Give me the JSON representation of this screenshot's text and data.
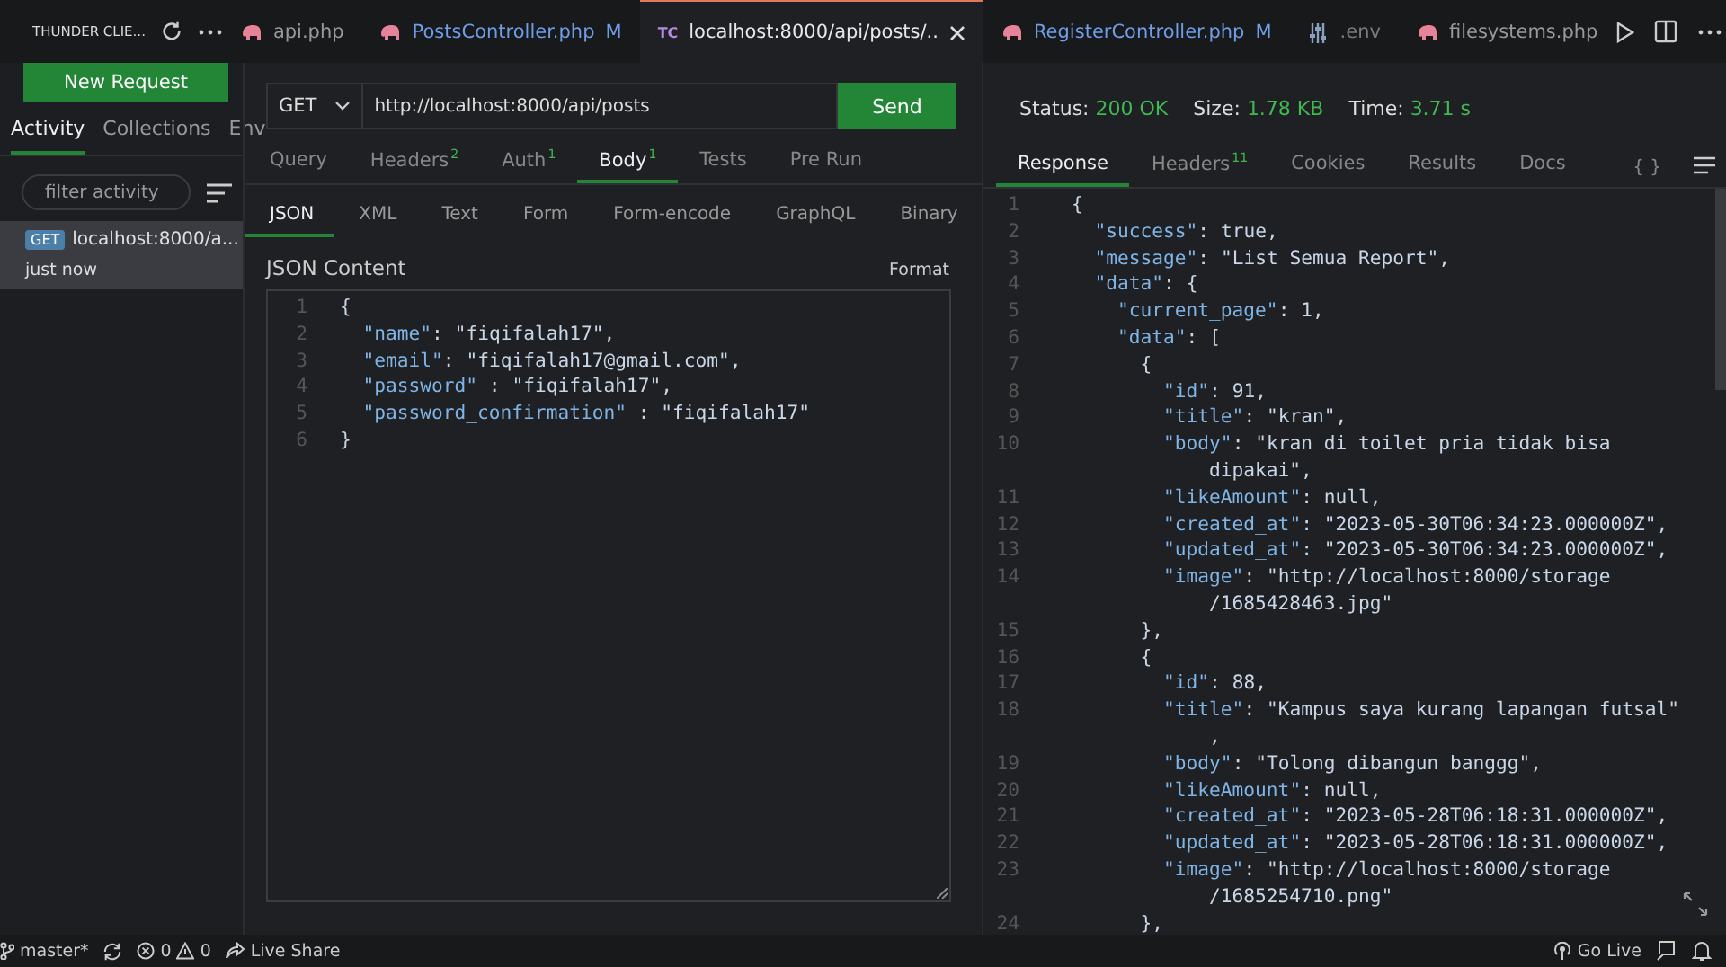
{
  "editor_tabs": [
    {
      "label": "api.php",
      "kind": "php",
      "selected": false
    },
    {
      "label": "PostsController.php",
      "kind": "php",
      "modified": "M",
      "selected": false
    },
    {
      "label": "localhost:8000/api/posts/..",
      "kind": "thunder",
      "icon_text": "TC",
      "selected": true
    },
    {
      "label": "RegisterController.php",
      "kind": "php",
      "modified": "M",
      "selected": false
    },
    {
      "label": ".env",
      "kind": "env",
      "selected": false
    },
    {
      "label": "filesystems.php",
      "kind": "php",
      "selected": false
    }
  ],
  "sidebar": {
    "title": "THUNDER CLIE...",
    "new_request": "New Request",
    "tabs": [
      {
        "label": "Activity",
        "selected": true
      },
      {
        "label": "Collections",
        "selected": false
      },
      {
        "label": "Env",
        "selected": false
      }
    ],
    "filter": {
      "placeholder": "filter activity"
    },
    "items": [
      {
        "method": "GET",
        "url": "localhost:8000/a...",
        "time": "just now",
        "selected": true
      }
    ]
  },
  "request": {
    "method": "GET",
    "url": "http://localhost:8000/api/posts",
    "send": "Send",
    "tabs": [
      {
        "label": "Query",
        "selected": false
      },
      {
        "label": "Headers",
        "badge": "2",
        "selected": false
      },
      {
        "label": "Auth",
        "badge": "1",
        "selected": false
      },
      {
        "label": "Body",
        "badge": "1",
        "selected": true
      },
      {
        "label": "Tests",
        "selected": false
      },
      {
        "label": "Pre Run",
        "selected": false
      }
    ],
    "body_tabs": [
      {
        "label": "JSON",
        "selected": true
      },
      {
        "label": "XML",
        "selected": false
      },
      {
        "label": "Text",
        "selected": false
      },
      {
        "label": "Form",
        "selected": false
      },
      {
        "label": "Form-encode",
        "selected": false
      },
      {
        "label": "GraphQL",
        "selected": false
      },
      {
        "label": "Binary",
        "selected": false
      }
    ],
    "content_label": "JSON Content",
    "format": "Format",
    "lines": [
      {
        "number": "1",
        "text": "{"
      },
      {
        "number": "2",
        "text": "  \"name\": \"fiqifalah17\","
      },
      {
        "number": "3",
        "text": "  \"email\": \"fiqifalah17@gmail.com\","
      },
      {
        "number": "4",
        "text": "  \"password\" : \"fiqifalah17\","
      },
      {
        "number": "5",
        "text": "  \"password_confirmation\" : \"fiqifalah17\""
      },
      {
        "number": "6",
        "text": "}"
      }
    ]
  },
  "response": {
    "status_label": "Status:",
    "status": "200 OK",
    "size_label": "Size:",
    "size": "1.78 KB",
    "time_label": "Time:",
    "time": "3.71 s",
    "tabs": [
      {
        "label": "Response",
        "selected": true
      },
      {
        "label": "Headers",
        "badge": "11",
        "selected": false
      },
      {
        "label": "Cookies",
        "selected": false
      },
      {
        "label": "Results",
        "selected": false
      },
      {
        "label": "Docs",
        "selected": false
      }
    ],
    "braces": "{ }",
    "lines": [
      {
        "number": "1",
        "text": "{"
      },
      {
        "number": "2",
        "text": "  \"success\": true,"
      },
      {
        "number": "3",
        "text": "  \"message\": \"List Semua Report\","
      },
      {
        "number": "4",
        "text": "  \"data\": {"
      },
      {
        "number": "5",
        "text": "    \"current_page\": 1,"
      },
      {
        "number": "6",
        "text": "    \"data\": ["
      },
      {
        "number": "7",
        "text": "      {"
      },
      {
        "number": "8",
        "text": "        \"id\": 91,"
      },
      {
        "number": "9",
        "text": "        \"title\": \"kran\","
      },
      {
        "number": "10",
        "text": "        \"body\": \"kran di toilet pria tidak bisa"
      },
      {
        "text": "            dipakai\","
      },
      {
        "number": "11",
        "text": "        \"likeAmount\": null,"
      },
      {
        "number": "12",
        "text": "        \"created_at\": \"2023-05-30T06:34:23.000000Z\","
      },
      {
        "number": "13",
        "text": "        \"updated_at\": \"2023-05-30T06:34:23.000000Z\","
      },
      {
        "number": "14",
        "text": "        \"image\": \"http://localhost:8000/storage"
      },
      {
        "text": "            /1685428463.jpg\""
      },
      {
        "number": "15",
        "text": "      },"
      },
      {
        "number": "16",
        "text": "      {"
      },
      {
        "number": "17",
        "text": "        \"id\": 88,"
      },
      {
        "number": "18",
        "text": "        \"title\": \"Kampus saya kurang lapangan futsal\""
      },
      {
        "text": "            ,"
      },
      {
        "number": "19",
        "text": "        \"body\": \"Tolong dibangun banggg\","
      },
      {
        "number": "20",
        "text": "        \"likeAmount\": null,"
      },
      {
        "number": "21",
        "text": "        \"created_at\": \"2023-05-28T06:18:31.000000Z\","
      },
      {
        "number": "22",
        "text": "        \"updated_at\": \"2023-05-28T06:18:31.000000Z\","
      },
      {
        "number": "23",
        "text": "        \"image\": \"http://localhost:8000/storage"
      },
      {
        "text": "            /1685254710.png\""
      },
      {
        "number": "24",
        "text": "      },"
      }
    ]
  },
  "status_bar": {
    "branch": "master*",
    "errors": "0",
    "warnings": "0",
    "live_share": "Live Share",
    "go_live": "Go Live"
  }
}
